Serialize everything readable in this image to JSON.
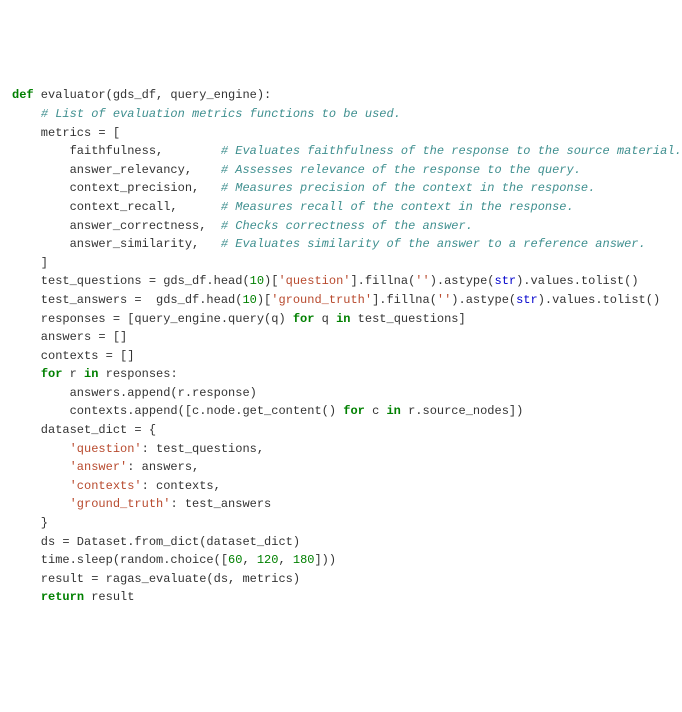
{
  "code": {
    "l01": [
      [
        "k",
        "def"
      ],
      [
        "n",
        " evaluator(gds_df, query_engine):"
      ]
    ],
    "l02": [
      [
        "n",
        "    "
      ],
      [
        "c",
        "# List of evaluation metrics functions to be used."
      ]
    ],
    "l03": [
      [
        "n",
        "    metrics = ["
      ]
    ],
    "l04": [
      [
        "n",
        "        faithfulness,        "
      ],
      [
        "c",
        "# Evaluates faithfulness of the response to the source material."
      ]
    ],
    "l05": [
      [
        "n",
        "        answer_relevancy,    "
      ],
      [
        "c",
        "# Assesses relevance of the response to the query."
      ]
    ],
    "l06": [
      [
        "n",
        "        context_precision,   "
      ],
      [
        "c",
        "# Measures precision of the context in the response."
      ]
    ],
    "l07": [
      [
        "n",
        "        context_recall,      "
      ],
      [
        "c",
        "# Measures recall of the context in the response."
      ]
    ],
    "l08": [
      [
        "n",
        "        answer_correctness,  "
      ],
      [
        "c",
        "# Checks correctness of the answer."
      ]
    ],
    "l09": [
      [
        "n",
        "        answer_similarity,   "
      ],
      [
        "c",
        "# Evaluates similarity of the answer to a reference answer."
      ]
    ],
    "l10": [
      [
        "n",
        "    ]"
      ]
    ],
    "l11": [
      [
        "n",
        ""
      ]
    ],
    "l12": [
      [
        "n",
        "    test_questions = gds_df.head("
      ],
      [
        "num",
        "10"
      ],
      [
        "n",
        ")["
      ],
      [
        "s",
        "'question'"
      ],
      [
        "n",
        "].fillna("
      ],
      [
        "s",
        "''"
      ],
      [
        "n",
        ").astype("
      ],
      [
        "fn",
        "str"
      ],
      [
        "n",
        ").values.tolist()"
      ]
    ],
    "l13": [
      [
        "n",
        "    test_answers =  gds_df.head("
      ],
      [
        "num",
        "10"
      ],
      [
        "n",
        ")["
      ],
      [
        "s",
        "'ground_truth'"
      ],
      [
        "n",
        "].fillna("
      ],
      [
        "s",
        "''"
      ],
      [
        "n",
        ").astype("
      ],
      [
        "fn",
        "str"
      ],
      [
        "n",
        ").values.tolist()"
      ]
    ],
    "l14": [
      [
        "n",
        ""
      ]
    ],
    "l15": [
      [
        "n",
        ""
      ]
    ],
    "l16": [
      [
        "n",
        "    responses = [query_engine.query(q) "
      ],
      [
        "k",
        "for"
      ],
      [
        "n",
        " q "
      ],
      [
        "k",
        "in"
      ],
      [
        "n",
        " test_questions]"
      ]
    ],
    "l17": [
      [
        "n",
        "    answers = []"
      ]
    ],
    "l18": [
      [
        "n",
        "    contexts = []"
      ]
    ],
    "l19": [
      [
        "n",
        "    "
      ],
      [
        "k",
        "for"
      ],
      [
        "n",
        " r "
      ],
      [
        "k",
        "in"
      ],
      [
        "n",
        " responses:"
      ]
    ],
    "l20": [
      [
        "n",
        "        answers.append(r.response)"
      ]
    ],
    "l21": [
      [
        "n",
        "        contexts.append([c.node.get_content() "
      ],
      [
        "k",
        "for"
      ],
      [
        "n",
        " c "
      ],
      [
        "k",
        "in"
      ],
      [
        "n",
        " r.source_nodes])"
      ]
    ],
    "l22": [
      [
        "n",
        ""
      ]
    ],
    "l23": [
      [
        "n",
        "    dataset_dict = {"
      ]
    ],
    "l24": [
      [
        "n",
        "        "
      ],
      [
        "s",
        "'question'"
      ],
      [
        "n",
        ": test_questions,"
      ]
    ],
    "l25": [
      [
        "n",
        "        "
      ],
      [
        "s",
        "'answer'"
      ],
      [
        "n",
        ": answers,"
      ]
    ],
    "l26": [
      [
        "n",
        "        "
      ],
      [
        "s",
        "'contexts'"
      ],
      [
        "n",
        ": contexts,"
      ]
    ],
    "l27": [
      [
        "n",
        "        "
      ],
      [
        "s",
        "'ground_truth'"
      ],
      [
        "n",
        ": test_answers"
      ]
    ],
    "l28": [
      [
        "n",
        "    }"
      ]
    ],
    "l29": [
      [
        "n",
        ""
      ]
    ],
    "l30": [
      [
        "n",
        "    ds = Dataset.from_dict(dataset_dict)"
      ]
    ],
    "l31": [
      [
        "n",
        "    time.sleep(random.choice(["
      ],
      [
        "num",
        "60"
      ],
      [
        "n",
        ", "
      ],
      [
        "num",
        "120"
      ],
      [
        "n",
        ", "
      ],
      [
        "num",
        "180"
      ],
      [
        "n",
        "]))"
      ]
    ],
    "l32": [
      [
        "n",
        "    result = ragas_evaluate(ds, metrics)"
      ]
    ],
    "l33": [
      [
        "n",
        ""
      ]
    ],
    "l34": [
      [
        "n",
        "    "
      ],
      [
        "k",
        "return"
      ],
      [
        "n",
        " result"
      ]
    ]
  },
  "order": [
    "l01",
    "l02",
    "l03",
    "l04",
    "l05",
    "l06",
    "l07",
    "l08",
    "l09",
    "l10",
    "l11",
    "l12",
    "l13",
    "l14",
    "l15",
    "l16",
    "l17",
    "l18",
    "l19",
    "l20",
    "l21",
    "l22",
    "l23",
    "l24",
    "l25",
    "l26",
    "l27",
    "l28",
    "l29",
    "l30",
    "l31",
    "l32",
    "l33",
    "l34"
  ]
}
